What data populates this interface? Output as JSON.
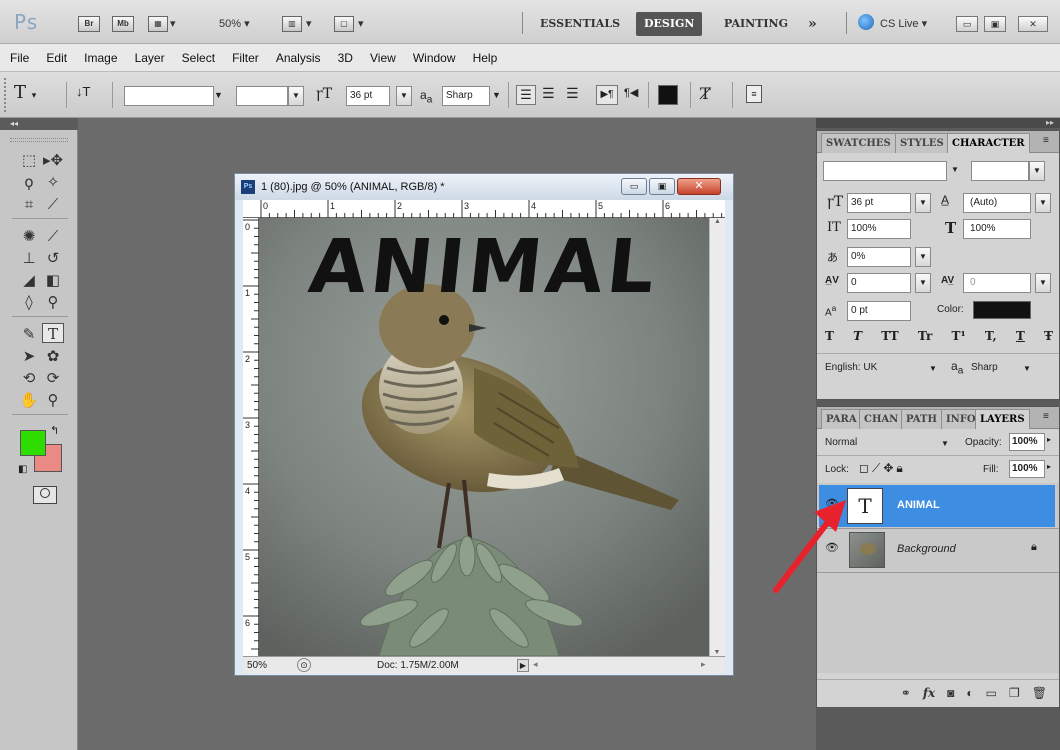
{
  "appbar": {
    "logo": "Ps",
    "launchers": [
      "Br",
      "Mb"
    ],
    "zoom": "50%",
    "workspaces": [
      "ESSENTIALS",
      "DESIGN",
      "PAINTING"
    ],
    "active_workspace": "DESIGN",
    "more": "»",
    "cs_live": "CS Live"
  },
  "menu": [
    "File",
    "Edit",
    "Image",
    "Layer",
    "Select",
    "Filter",
    "Analysis",
    "3D",
    "View",
    "Window",
    "Help"
  ],
  "options": {
    "tool_label": "T",
    "font_size": "36 pt",
    "aa_prefix": "a",
    "aa_sub": "a",
    "antialias": "Sharp"
  },
  "colors": {
    "foreground": "#2fdc00",
    "background": "#e98a86",
    "layer_highlight": "#3d8ee3",
    "text_color": "#111111",
    "arrow": "#e8222d"
  },
  "document": {
    "title": "1 (80).jpg @ 50% (ANIMAL, RGB/8) *",
    "badge": "Ps",
    "canvas_text": "ANIMAL",
    "ruler_h": [
      "0",
      "1",
      "2",
      "3",
      "4",
      "5",
      "6"
    ],
    "ruler_v": [
      "0",
      "1",
      "2",
      "3",
      "4",
      "5",
      "6"
    ],
    "zoom": "50%",
    "doc_size": "Doc: 1.75M/2.00M"
  },
  "character_panel": {
    "tabs": [
      "SWATCHES",
      "STYLES",
      "CHARACTER"
    ],
    "active_tab": "CHARACTER",
    "size": "36 pt",
    "leading": "(Auto)",
    "vscale": "100%",
    "hscale": "100%",
    "tsume": "0%",
    "kerning": "0",
    "tracking": "0",
    "baseline": "0 pt",
    "color_label": "Color:",
    "style_buttons": [
      "T",
      "T",
      "TT",
      "Tr",
      "T¹",
      "T,",
      "T",
      "Ŧ"
    ],
    "language": "English: UK",
    "aa_prefix": "a",
    "aa_sub": "a",
    "antialias": "Sharp"
  },
  "layers_panel": {
    "tabs": [
      "PARA",
      "CHAN",
      "PATH",
      "INFO",
      "LAYERS"
    ],
    "active_tab": "LAYERS",
    "blend_mode": "Normal",
    "opacity_label": "Opacity:",
    "opacity": "100%",
    "lock_label": "Lock:",
    "fill_label": "Fill:",
    "fill": "100%",
    "layers": [
      {
        "name": "ANIMAL",
        "thumb": "T",
        "selected": true
      },
      {
        "name": "Background",
        "thumb": "",
        "selected": false
      }
    ],
    "footer_fx": "fx"
  }
}
